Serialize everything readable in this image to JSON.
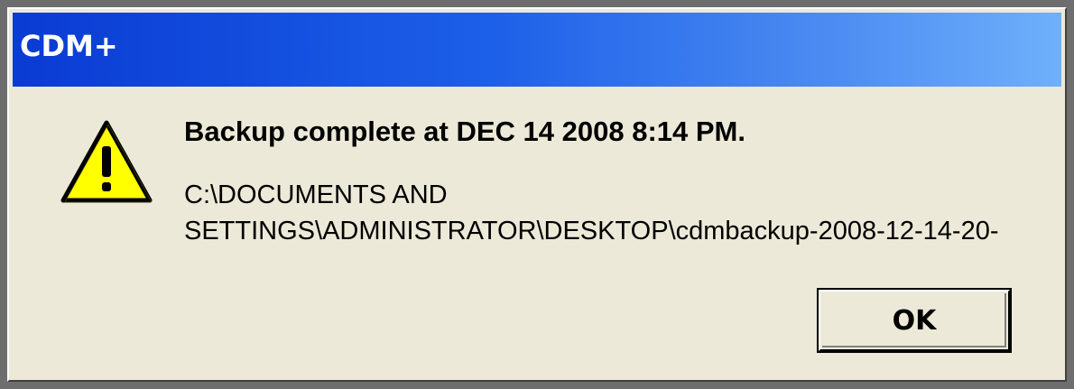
{
  "window": {
    "title": "CDM+"
  },
  "message": {
    "headline": "Backup complete at DEC 14 2008 8:14 PM.",
    "path_line1": "C:\\DOCUMENTS AND",
    "path_line2": "SETTINGS\\ADMINISTRATOR\\DESKTOP\\cdmbackup-2008-12-14-20-"
  },
  "icons": {
    "warning": "warning-icon"
  },
  "buttons": {
    "ok_label": "OK"
  },
  "colors": {
    "titlebar_start": "#0a3bd3",
    "titlebar_end": "#6fb0fb",
    "dialog_face": "#ece9d8",
    "warning_fill": "#ffff00"
  }
}
